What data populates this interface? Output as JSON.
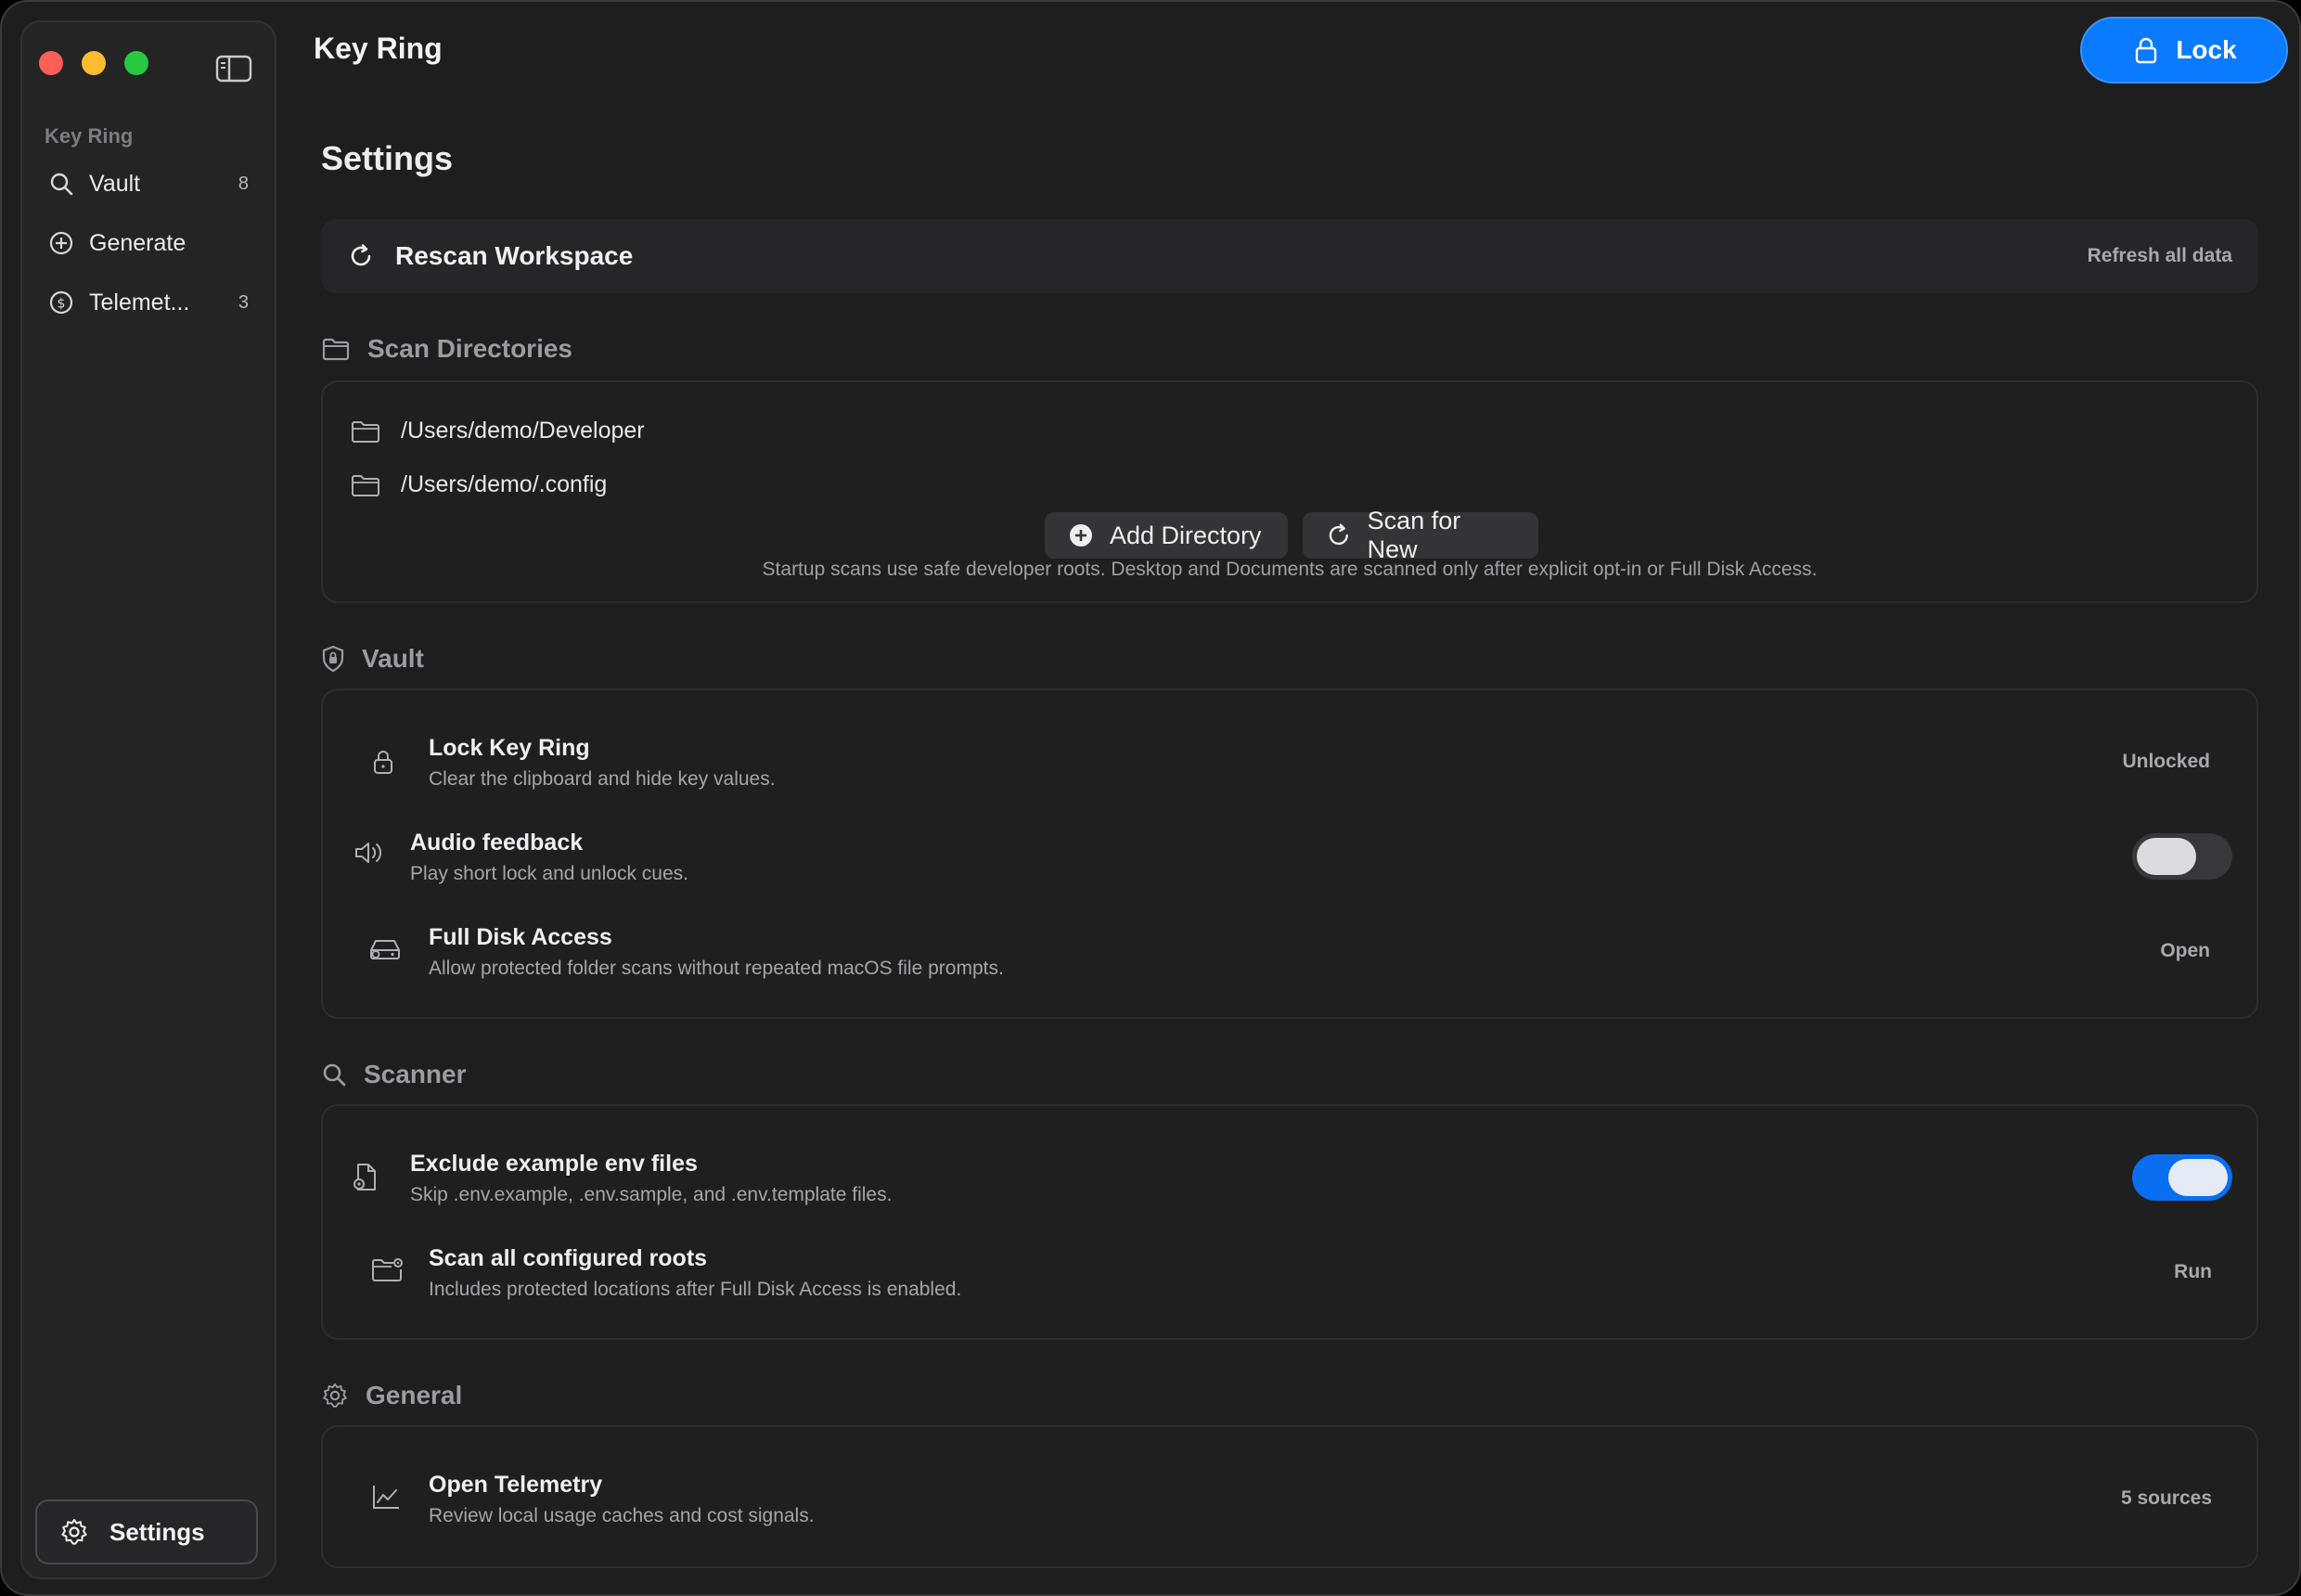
{
  "window": {
    "app_title": "Key Ring",
    "lock_button": "Lock"
  },
  "sidebar": {
    "section_label": "Key Ring",
    "items": [
      {
        "label": "Vault",
        "count": "8",
        "icon": "search-icon"
      },
      {
        "label": "Generate",
        "count": "",
        "icon": "plus-circle-icon"
      },
      {
        "label": "Telemet...",
        "count": "3",
        "icon": "dollar-circle-icon"
      }
    ],
    "settings_label": "Settings"
  },
  "main": {
    "page_title": "Settings",
    "rescan": {
      "label": "Rescan Workspace",
      "action": "Refresh all data"
    },
    "scan_directories": {
      "heading": "Scan Directories",
      "directories": [
        "/Users/demo/Developer",
        "/Users/demo/.config"
      ],
      "add_button": "Add Directory",
      "scan_button": "Scan for New",
      "hint": "Startup scans use safe developer roots. Desktop and Documents are scanned only after explicit opt-in or Full Disk Access."
    },
    "vault": {
      "heading": "Vault",
      "rows": [
        {
          "title": "Lock Key Ring",
          "subtitle": "Clear the clipboard and hide key values.",
          "value": "Unlocked"
        },
        {
          "title": "Audio feedback",
          "subtitle": "Play short lock and unlock cues.",
          "toggle": false
        },
        {
          "title": "Full Disk Access",
          "subtitle": "Allow protected folder scans without repeated macOS file prompts.",
          "value": "Open"
        }
      ]
    },
    "scanner": {
      "heading": "Scanner",
      "rows": [
        {
          "title": "Exclude example env files",
          "subtitle": "Skip .env.example, .env.sample, and .env.template files.",
          "toggle": true
        },
        {
          "title": "Scan all configured roots",
          "subtitle": "Includes protected locations after Full Disk Access is enabled.",
          "value": "Run"
        }
      ]
    },
    "general": {
      "heading": "General",
      "rows": [
        {
          "title": "Open Telemetry",
          "subtitle": "Review local usage caches and cost signals.",
          "value": "5 sources"
        }
      ]
    }
  },
  "colors": {
    "accent": "#0a7aff",
    "background": "#1e1e1f",
    "sidebar": "#242425"
  }
}
